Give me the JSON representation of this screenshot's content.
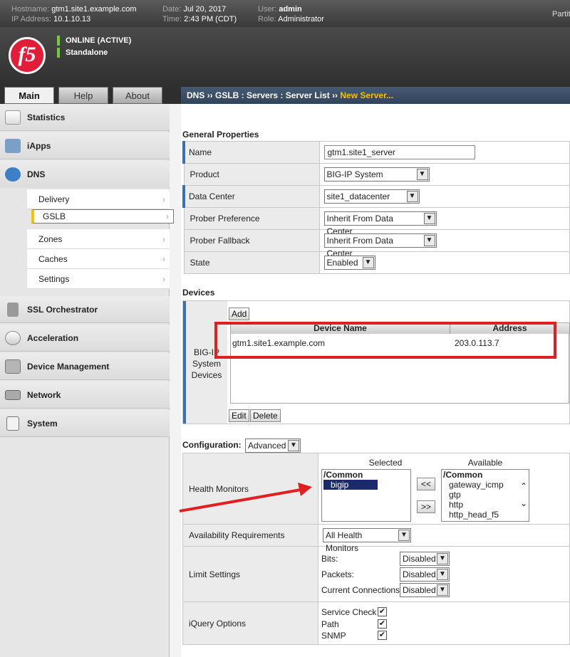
{
  "header": {
    "hostname_label": "Hostname:",
    "hostname": "gtm1.site1.example.com",
    "ip_label": "IP Address:",
    "ip": "10.1.10.13",
    "date_label": "Date:",
    "date": "Jul 20, 2017",
    "time_label": "Time:",
    "time": "2:43 PM (CDT)",
    "user_label": "User:",
    "user": "admin",
    "role_label": "Role:",
    "role": "Administrator",
    "partition_label": "Partiti"
  },
  "logo": {
    "text": "f5"
  },
  "status": {
    "online": "ONLINE (ACTIVE)",
    "mode": "Standalone"
  },
  "tabs": {
    "main": "Main",
    "help": "Help",
    "about": "About"
  },
  "breadcrumb": {
    "path": "DNS ›› GSLB : Servers : Server List ›› ",
    "current": "New Server..."
  },
  "sidebar": {
    "statistics": "Statistics",
    "iapps": "iApps",
    "dns": "DNS",
    "dns_sub": [
      "Delivery",
      "GSLB",
      "Zones",
      "Caches",
      "Settings"
    ],
    "ssl": "SSL Orchestrator",
    "acceleration": "Acceleration",
    "device_mgmt": "Device Management",
    "network": "Network",
    "system": "System"
  },
  "general": {
    "heading": "General Properties",
    "name_label": "Name",
    "name_value": "gtm1.site1_server",
    "product_label": "Product",
    "product_value": "BIG-IP System",
    "dc_label": "Data Center",
    "dc_value": "site1_datacenter",
    "prober_pref_label": "Prober Preference",
    "prober_pref_value": "Inherit From Data Center",
    "prober_fb_label": "Prober Fallback",
    "prober_fb_value": "Inherit From Data Center",
    "state_label": "State",
    "state_value": "Enabled"
  },
  "devices": {
    "heading": "Devices",
    "label_line1": "BIG-IP",
    "label_line2": "System",
    "label_line3": "Devices",
    "add": "Add",
    "col_name": "Device Name",
    "col_address": "Address",
    "row_name": "gtm1.site1.example.com",
    "row_address": "203.0.113.7",
    "edit": "Edit",
    "delete": "Delete"
  },
  "config": {
    "label": "Configuration:",
    "mode": "Advanced",
    "hm_label": "Health Monitors",
    "selected_label": "Selected",
    "available_label": "Available",
    "selected_group": "/Common",
    "selected_items": [
      "bigip"
    ],
    "available_group": "/Common",
    "available_items": [
      "gateway_icmp",
      "gtp",
      "http",
      "http_head_f5"
    ],
    "move_left": "<<",
    "move_right": ">>",
    "avail_req_label": "Availability Requirements",
    "avail_req_value": "All Health Monitors",
    "limit_label": "Limit Settings",
    "bits_label": "Bits:",
    "bits_value": "Disabled",
    "packets_label": "Packets:",
    "packets_value": "Disabled",
    "conn_label": "Current Connections:",
    "conn_value": "Disabled",
    "iquery_label": "iQuery Options",
    "service_check": "Service Check",
    "path": "Path",
    "snmp": "SNMP"
  },
  "colors": {
    "accent_yellow": "#f5c200",
    "annotation_red": "#e02020",
    "nav_blue": "#3a6fb0"
  }
}
